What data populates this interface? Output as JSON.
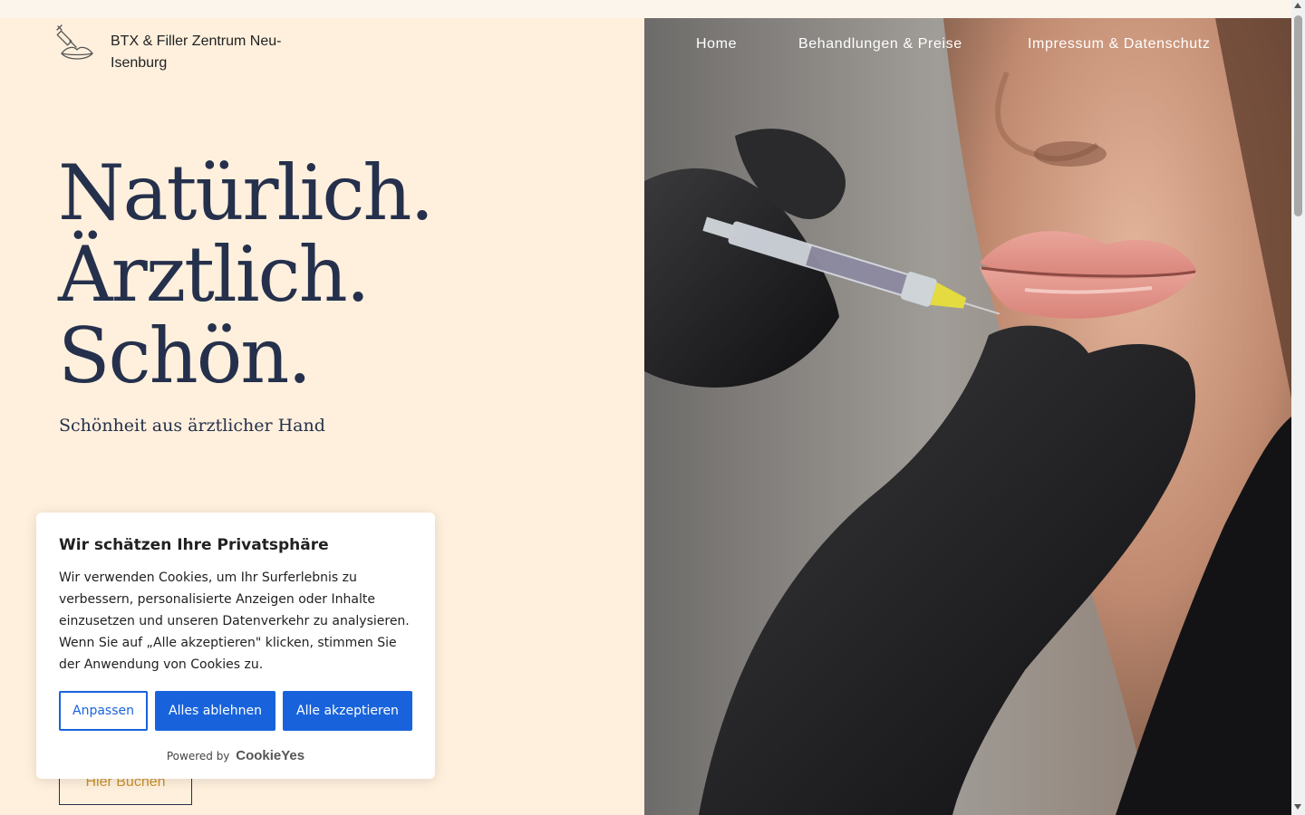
{
  "header": {
    "brand": "BTX & Filler Zentrum Neu-Isenburg",
    "nav": [
      "Home",
      "Behandlungen & Preise",
      "Impressum & Datenschutz"
    ]
  },
  "hero": {
    "headline": [
      "Natürlich.",
      "Ärztlich.",
      "Schön."
    ],
    "tagline": "Schönheit aus ärztlicher Hand",
    "book_button": "Hier Buchen"
  },
  "cookie_banner": {
    "title": "Wir schätzen Ihre Privatsphäre",
    "text": "Wir verwenden Cookies, um Ihr Surferlebnis zu verbessern, personalisierte Anzeigen oder Inhalte einzusetzen und unseren Datenverkehr zu analysieren. Wenn Sie auf „Alle akzeptieren\" klicken, stimmen Sie der Anwendung von Cookies zu.",
    "customize": "Anpassen",
    "reject_all": "Alles ablehnen",
    "accept_all": "Alle akzeptieren",
    "powered_by": "Powered by",
    "powered_brand": "CookieYes"
  },
  "colors": {
    "background": "#fff0dd",
    "heading": "#25304c",
    "accent": "#c9922a",
    "cookie_button": "#1863dc"
  },
  "icons": {
    "logo": "syringe-lips-icon"
  }
}
